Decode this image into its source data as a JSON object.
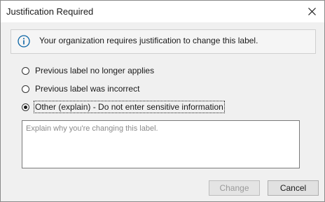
{
  "dialog": {
    "title": "Justification Required",
    "close_icon": "close-icon"
  },
  "info": {
    "icon": "info-icon",
    "text": "Your organization requires justification to change this label."
  },
  "options": [
    {
      "label": "Previous label no longer applies",
      "checked": false
    },
    {
      "label": "Previous label was incorrect",
      "checked": false
    },
    {
      "label": "Other (explain) - Do not enter sensitive information",
      "checked": true
    }
  ],
  "explanation": {
    "value": "",
    "placeholder": "Explain why you're changing this label."
  },
  "buttons": {
    "change": {
      "label": "Change",
      "enabled": false
    },
    "cancel": {
      "label": "Cancel",
      "enabled": true
    }
  },
  "colors": {
    "accent": "#0a64a4",
    "dialog_bg": "#f0f0f0",
    "titlebar_bg": "#ffffff"
  }
}
